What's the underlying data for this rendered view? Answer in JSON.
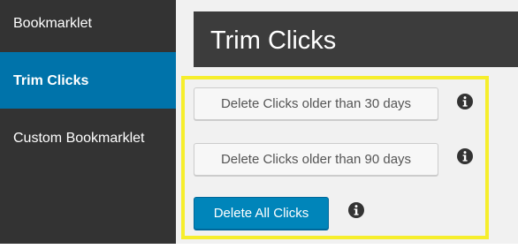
{
  "sidebar": {
    "items": [
      {
        "label": "Bookmarklet"
      },
      {
        "label": "Trim Clicks",
        "active": true
      },
      {
        "label": "Custom Bookmarklet"
      }
    ]
  },
  "header": {
    "title": "Trim Clicks"
  },
  "actions": {
    "delete_30_label": "Delete Clicks older than 30 days",
    "delete_90_label": "Delete Clicks older than 90 days",
    "delete_all_label": "Delete All Clicks",
    "info_icon": "info-icon"
  },
  "colors": {
    "sidebar_bg": "#333333",
    "active_item_bg": "#0073aa",
    "header_bg": "#3c3c3c",
    "primary_button": "#0085ba",
    "highlight_border": "#f6ee2c"
  }
}
